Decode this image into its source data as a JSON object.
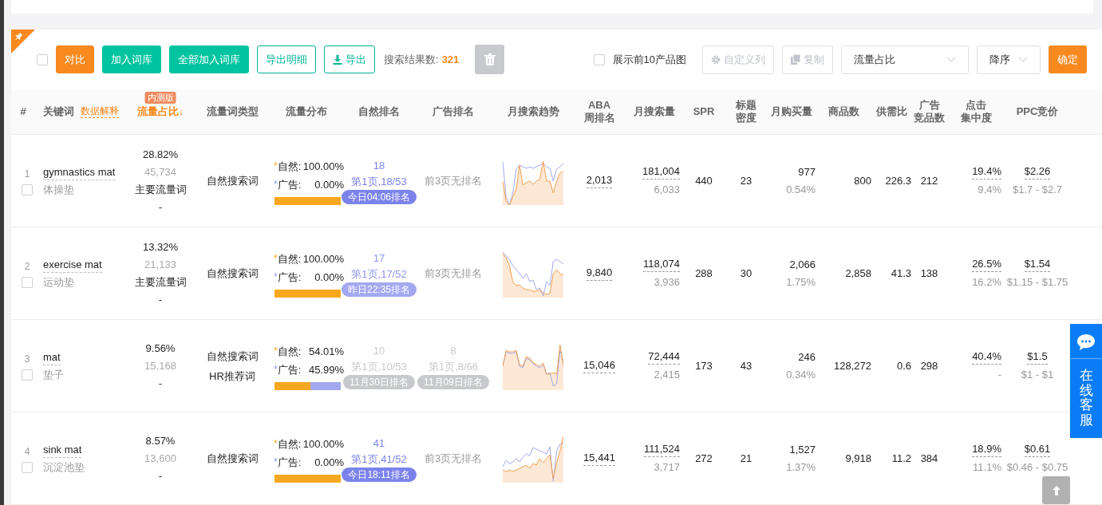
{
  "toolbar": {
    "select_all": {
      "checked": false
    },
    "buttons": [
      {
        "label": "对比",
        "kind": "orange"
      },
      {
        "label": "加入词库",
        "kind": "teal"
      },
      {
        "label": "全部加入词库",
        "kind": "teal"
      },
      {
        "label": "导出明细",
        "kind": "outline"
      },
      {
        "label": "导出",
        "kind": "outline-icon"
      }
    ],
    "result_label": "搜索结果数:",
    "result_count": "321",
    "show_top10": {
      "label": "展示前10产品图",
      "checked": false
    },
    "custom_columns": "自定义列",
    "copy": "复制",
    "sort_field": "流量占比",
    "sort_order": "降序",
    "confirm": "确定"
  },
  "columns": [
    {
      "lines": [
        "#"
      ]
    },
    {
      "lines": [
        "关键词"
      ],
      "link": "数据解释"
    },
    {
      "lines": [
        "流量占比"
      ],
      "badge": "内测版",
      "sort_mark": "↓",
      "selected": true
    },
    {
      "lines": [
        "流量词类型"
      ]
    },
    {
      "lines": [
        "流量分布"
      ]
    },
    {
      "lines": [
        "自然排名"
      ]
    },
    {
      "lines": [
        "广告排名"
      ]
    },
    {
      "lines": [
        "月搜索趋势"
      ]
    },
    {
      "lines": [
        "ABA",
        "周排名"
      ]
    },
    {
      "lines": [
        "月搜索量"
      ]
    },
    {
      "lines": [
        "SPR"
      ]
    },
    {
      "lines": [
        "标题",
        "密度"
      ]
    },
    {
      "lines": [
        "月购买量"
      ]
    },
    {
      "lines": [
        "商品数"
      ]
    },
    {
      "lines": [
        "供需比"
      ]
    },
    {
      "lines": [
        "广告",
        "竞品数"
      ]
    },
    {
      "lines": [
        "点击",
        "集中度"
      ]
    },
    {
      "lines": [
        "PPC竞价"
      ]
    }
  ],
  "rows": [
    {
      "index": "1",
      "checked": false,
      "keyword": "gymnastics mat",
      "translation": "体操垫",
      "share": "28.82%",
      "share_count": "45,734",
      "share_tag": "主要流量词",
      "share_extra": "-",
      "word_types": [
        "自然搜索词"
      ],
      "natural_label": "自然:",
      "natural_pct": "100.00%",
      "ad_label": "广告:",
      "ad_pct": "0.00%",
      "level": 1.0,
      "natural_rank": {
        "kind": "today",
        "rank": "18",
        "position": "第1页,18/53",
        "badge": "今日04:06排名"
      },
      "ad_rank": {
        "kind": "none",
        "text": "前3页无排名"
      },
      "aba": "2,013",
      "monthly_search": "181,004",
      "monthly_search_sub": "6,033",
      "spr": "440",
      "title_density": "23",
      "monthly_buy": "977",
      "buy_rate": "0.54%",
      "products": "800",
      "supply_ratio": "226.3",
      "ad_products": "212",
      "click_conc": "19.4%",
      "click_conc_sub": "9.4%",
      "ppc": "$2.26",
      "ppc_range": "$1.7 - $2.7"
    },
    {
      "index": "2",
      "checked": false,
      "keyword": "exercise mat",
      "translation": "运动垫",
      "share": "13.32%",
      "share_count": "21,133",
      "share_tag": "主要流量词",
      "share_extra": "-",
      "word_types": [
        "自然搜索词"
      ],
      "natural_label": "自然:",
      "natural_pct": "100.00%",
      "ad_label": "广告:",
      "ad_pct": "0.00%",
      "level": 1.0,
      "natural_rank": {
        "kind": "yesterday",
        "rank": "17",
        "position": "第1页,17/52",
        "badge": "昨日22:35排名"
      },
      "ad_rank": {
        "kind": "none",
        "text": "前3页无排名"
      },
      "aba": "9,840",
      "monthly_search": "118,074",
      "monthly_search_sub": "3,936",
      "spr": "288",
      "title_density": "30",
      "monthly_buy": "2,066",
      "buy_rate": "1.75%",
      "products": "2,858",
      "supply_ratio": "41.3",
      "ad_products": "138",
      "click_conc": "26.5%",
      "click_conc_sub": "16.2%",
      "ppc": "$1.54",
      "ppc_range": "$1.15 - $1.75"
    },
    {
      "index": "3",
      "checked": false,
      "keyword": "mat",
      "translation": "垫子",
      "share": "9.56%",
      "share_count": "15,168",
      "share_extra": "-",
      "word_types": [
        "自然搜索词",
        "HR推荐词"
      ],
      "natural_label": "自然:",
      "natural_pct": "54.01%",
      "ad_label": "广告:",
      "ad_pct": "45.99%",
      "level": 0.54,
      "natural_rank": {
        "kind": "stale",
        "rank": "10",
        "position": "第1页,10/53",
        "badge": "11月30日排名"
      },
      "ad_rank": {
        "kind": "stale",
        "rank": "8",
        "position": "第1页,8/66",
        "badge": "11月09日排名"
      },
      "aba": "15,046",
      "monthly_search": "72,444",
      "monthly_search_sub": "2,415",
      "spr": "173",
      "title_density": "43",
      "monthly_buy": "246",
      "buy_rate": "0.34%",
      "products": "128,272",
      "supply_ratio": "0.6",
      "ad_products": "298",
      "click_conc": "40.4%",
      "click_conc_sub": "-",
      "ppc": "$1.5",
      "ppc_range": "$1 - $1"
    },
    {
      "index": "4",
      "checked": false,
      "keyword": "sink mat",
      "translation": "沉淀池垫",
      "share": "8.57%",
      "share_count": "13,600",
      "share_extra": "-",
      "word_types": [
        "自然搜索词"
      ],
      "natural_label": "自然:",
      "natural_pct": "100.00%",
      "ad_label": "广告:",
      "ad_pct": "0.00%",
      "level": 1.0,
      "natural_rank": {
        "kind": "today",
        "rank": "41",
        "position": "第1页,41/52",
        "badge": "今日18:11排名"
      },
      "ad_rank": {
        "kind": "none",
        "text": "前3页无排名"
      },
      "aba": "15,441",
      "monthly_search": "111,524",
      "monthly_search_sub": "3,717",
      "spr": "272",
      "title_density": "21",
      "monthly_buy": "1,527",
      "buy_rate": "1.37%",
      "products": "9,918",
      "supply_ratio": "11.2",
      "ad_products": "384",
      "click_conc": "18.9%",
      "click_conc_sub": "11.1%",
      "ppc": "$0.61",
      "ppc_range": "$0.46 - $0.75"
    }
  ],
  "share_mark": "*",
  "chat_widget": {
    "label": "在线客服"
  }
}
